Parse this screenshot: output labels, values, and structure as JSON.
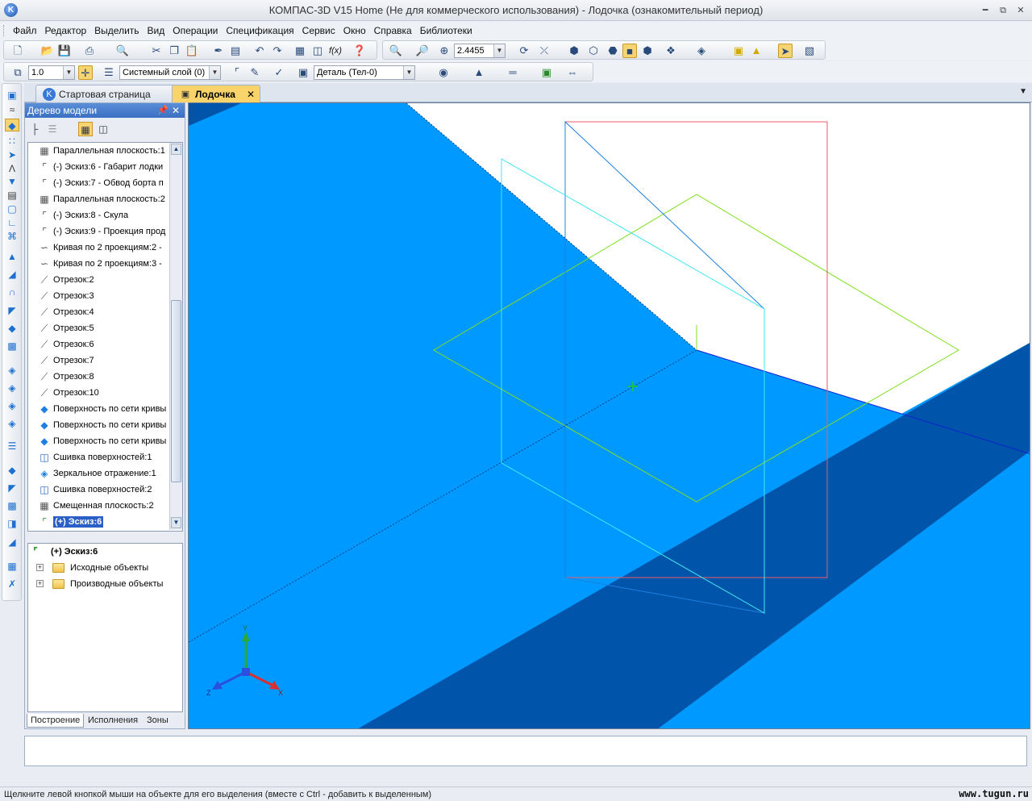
{
  "window": {
    "title": "КОМПАС-3D V15 Home (Не для коммерческого использования) - Лодочка (ознакомительный период)"
  },
  "menu": [
    "Файл",
    "Редактор",
    "Выделить",
    "Вид",
    "Операции",
    "Спецификация",
    "Сервис",
    "Окно",
    "Справка",
    "Библиотеки"
  ],
  "toolbar": {
    "zoom_value": "2.4455",
    "step_value": "1.0",
    "layer_value": "Системный слой (0)",
    "part_value": "Деталь (Тел-0)"
  },
  "tabs": {
    "start": "Стартовая страница",
    "doc": "Лодочка"
  },
  "panel": {
    "title": "Дерево модели",
    "tree": [
      {
        "label": "Параллельная плоскость:1",
        "icon": "plane-icon"
      },
      {
        "label": "(-) Эскиз:6 - Габарит лодки",
        "icon": "sketch-icon"
      },
      {
        "label": "(-) Эскиз:7 - Обвод борта п",
        "icon": "sketch-icon"
      },
      {
        "label": "Параллельная плоскость:2",
        "icon": "plane-icon"
      },
      {
        "label": "(-) Эскиз:8 - Скула",
        "icon": "sketch-icon"
      },
      {
        "label": "(-) Эскиз:9 - Проекция прод",
        "icon": "sketch-icon"
      },
      {
        "label": "Кривая по 2 проекциям:2 -",
        "icon": "curve-icon"
      },
      {
        "label": "Кривая по 2 проекциям:3 -",
        "icon": "curve-icon"
      },
      {
        "label": "Отрезок:2",
        "icon": "segment-icon"
      },
      {
        "label": "Отрезок:3",
        "icon": "segment-icon"
      },
      {
        "label": "Отрезок:4",
        "icon": "segment-icon"
      },
      {
        "label": "Отрезок:5",
        "icon": "segment-icon"
      },
      {
        "label": "Отрезок:6",
        "icon": "segment-icon"
      },
      {
        "label": "Отрезок:7",
        "icon": "segment-icon"
      },
      {
        "label": "Отрезок:8",
        "icon": "segment-icon"
      },
      {
        "label": "Отрезок:10",
        "icon": "segment-icon"
      },
      {
        "label": "Поверхность по сети кривы",
        "icon": "surface-icon"
      },
      {
        "label": "Поверхность по сети кривы",
        "icon": "surface-icon"
      },
      {
        "label": "Поверхность по сети кривы",
        "icon": "surface-icon"
      },
      {
        "label": "Сшивка поверхностей:1",
        "icon": "stitch-icon"
      },
      {
        "label": "Зеркальное отражение:1",
        "icon": "mirror-icon"
      },
      {
        "label": "Сшивка поверхностей:2",
        "icon": "stitch-icon"
      },
      {
        "label": "Смещенная плоскость:2",
        "icon": "plane-icon"
      },
      {
        "label": "(+) Эскиз:6",
        "icon": "sketch-active-icon"
      }
    ],
    "subtree": {
      "root": "(+) Эскиз:6",
      "children": [
        "Исходные объекты",
        "Производные объекты"
      ]
    },
    "tabs": [
      "Построение",
      "Исполнения",
      "Зоны"
    ]
  },
  "axes": {
    "x": "X",
    "y": "Y",
    "z": "Z"
  },
  "status": {
    "message": "Щелкните левой кнопкой мыши на объекте для его выделения (вместе с Ctrl - добавить к выделенным)",
    "watermark": "www.tugun.ru"
  },
  "colors": {
    "surface_light": "#0099ff",
    "surface_dark": "#0055aa",
    "accent_tab": "#f9d46a",
    "selection": "#2a5fc8"
  }
}
